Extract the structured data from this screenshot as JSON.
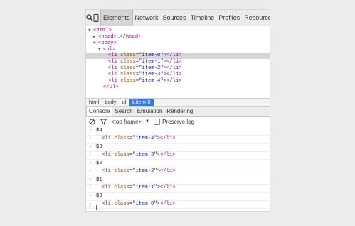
{
  "toolbar": {
    "tabs": [
      "Elements",
      "Network",
      "Sources",
      "Timeline",
      "Profiles",
      "Resources"
    ]
  },
  "tree": {
    "html_open": "<html>",
    "head": "<head>…</head>",
    "body_open": "<body>",
    "ul_open": "<ul>",
    "items": [
      {
        "open": "<li ",
        "attr": "class",
        "eq": "=",
        "val": "\"item-0\"",
        "close": "></li>"
      },
      {
        "open": "<li ",
        "attr": "class",
        "eq": "=",
        "val": "\"item-1\"",
        "close": "></li>"
      },
      {
        "open": "<li ",
        "attr": "class",
        "eq": "=",
        "val": "\"item-2\"",
        "close": "></li>"
      },
      {
        "open": "<li ",
        "attr": "class",
        "eq": "=",
        "val": "\"item-3\"",
        "close": "></li>"
      },
      {
        "open": "<li ",
        "attr": "class",
        "eq": "=",
        "val": "\"item-4\"",
        "close": "></li>"
      }
    ],
    "ul_close": "</ul>"
  },
  "breadcrumb": [
    "html",
    "body",
    "ul",
    "li.item-0"
  ],
  "drawer_tabs": [
    "Console",
    "Search",
    "Emulation",
    "Rendering"
  ],
  "console_toolbar": {
    "frame": "<top frame>",
    "preserve_log": "Preserve log"
  },
  "console": [
    {
      "cmd": "$4",
      "out": {
        "open": "<li ",
        "attr": "class",
        "eq": "=",
        "val": "\"item-4\"",
        "close": "></li>"
      }
    },
    {
      "cmd": "$3",
      "out": {
        "open": "<li ",
        "attr": "class",
        "eq": "=",
        "val": "\"item-3\"",
        "close": "></li>"
      }
    },
    {
      "cmd": "$2",
      "out": {
        "open": "<li ",
        "attr": "class",
        "eq": "=",
        "val": "\"item-2\"",
        "close": "></li>"
      }
    },
    {
      "cmd": "$1",
      "out": {
        "open": "<li ",
        "attr": "class",
        "eq": "=",
        "val": "\"item-1\"",
        "close": "></li>"
      }
    },
    {
      "cmd": "$0",
      "out": {
        "open": "<li ",
        "attr": "class",
        "eq": "=",
        "val": "\"item-0\"",
        "close": "></li>"
      }
    }
  ],
  "icons": {
    "search": "search-icon",
    "device": "device-icon",
    "clear": "clear-console-icon",
    "filter": "filter-icon"
  }
}
